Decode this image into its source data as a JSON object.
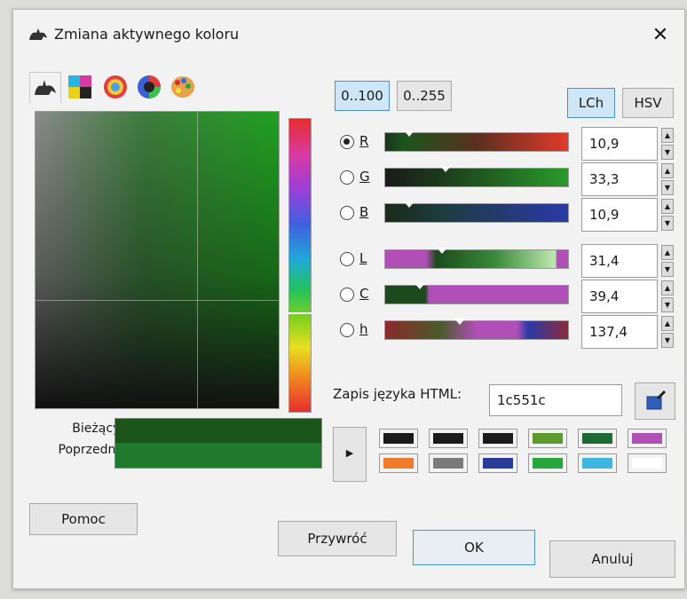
{
  "window": {
    "title": "Zmiana aktywnego koloru",
    "close_icon": "close-icon"
  },
  "tabs": [
    {
      "icon": "gimp-wilber-icon"
    },
    {
      "icon": "cmyk-icon",
      "letters": "CMYK"
    },
    {
      "icon": "watercolor-icon"
    },
    {
      "icon": "color-wheel-icon"
    },
    {
      "icon": "palette-icon"
    }
  ],
  "range_buttons": {
    "r100": "0..100",
    "r255": "0..255"
  },
  "mode_buttons": {
    "lch": "LCh",
    "hsv": "HSV"
  },
  "channels": [
    {
      "label": "R",
      "value": "10,9",
      "selected": true
    },
    {
      "label": "G",
      "value": "33,3",
      "selected": false
    },
    {
      "label": "B",
      "value": "10,9",
      "selected": false
    },
    {
      "label": "L",
      "value": "31,4",
      "selected": false
    },
    {
      "label": "C",
      "value": "39,4",
      "selected": false
    },
    {
      "label": "h",
      "value": "137,4",
      "selected": false
    }
  ],
  "html_notation": {
    "label": "Zapis języka HTML:",
    "value": "1c551c"
  },
  "current_label": "Bieżący:",
  "previous_label": "Poprzedni:",
  "current_color": "#1c551c",
  "previous_color": "#1f7a2e",
  "history_colors": [
    "#1a1a1a",
    "#1a1a1a",
    "#1a1a1a",
    "#5f9a2f",
    "#1c6a34",
    "#b04fb5",
    "#f07c2a",
    "#7a7a7a",
    "#283c9a",
    "#26a63c",
    "#3cb8e0",
    "#ffffff"
  ],
  "buttons": {
    "help": "Pomoc",
    "reset": "Przywróć",
    "ok": "OK",
    "cancel": "Anuluj"
  }
}
